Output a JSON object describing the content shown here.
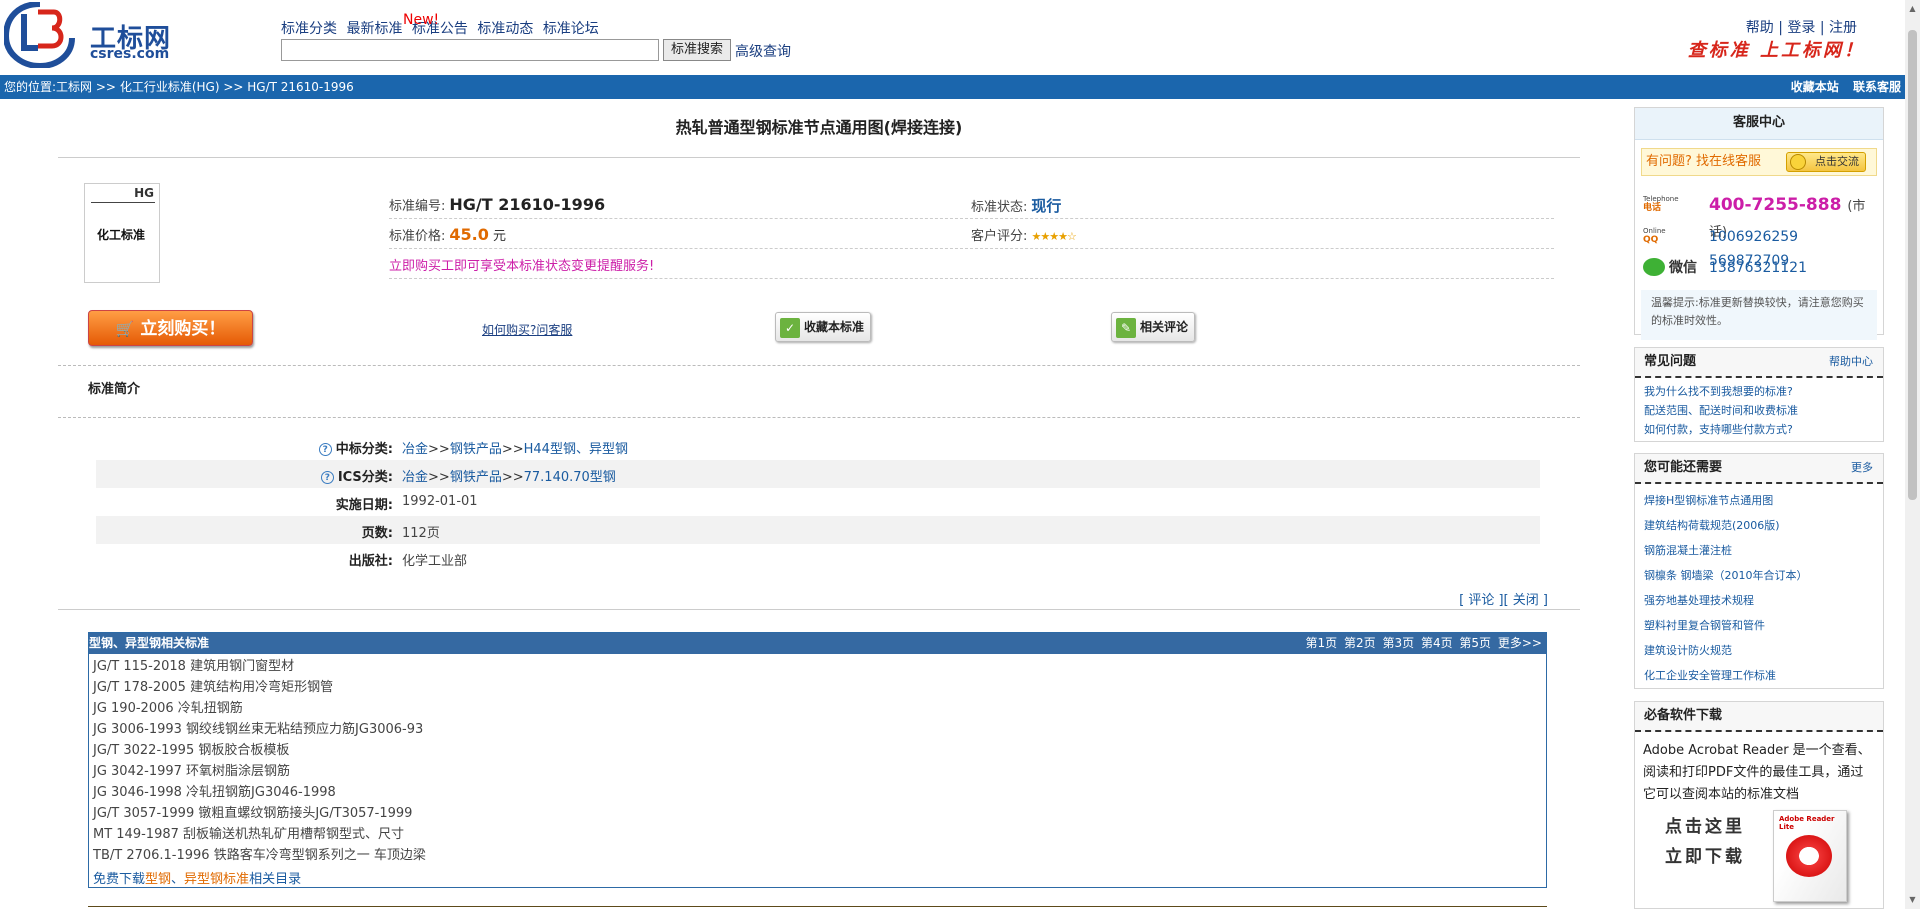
{
  "header": {
    "logo_cn": "工标网",
    "logo_en": "csres.com",
    "nav": [
      "标准分类",
      "最新标准",
      "标准公告",
      "标准动态",
      "标准论坛"
    ],
    "new_badge": "New!",
    "search_placeholder": "",
    "search_button": "标准搜索",
    "advanced_search": "高级查询",
    "links": [
      "帮助",
      "登录",
      "注册"
    ],
    "slogan": "查标准 上工标网！"
  },
  "breadcrumb": {
    "prefix": "您的位置:",
    "items": [
      "工标网",
      "化工行业标准(HG)",
      "HG/T 21610-1996"
    ],
    "right_links": [
      "收藏本站",
      "联系客服"
    ]
  },
  "standard": {
    "title": "热轧普通型钢标准节点通用图(焊接连接)",
    "thumb_code": "HG",
    "thumb_text": "化工标准",
    "code_label": "标准编号:",
    "code": "HG/T 21610-1996",
    "status_label": "标准状态:",
    "status": "现行",
    "price_label": "标准价格:",
    "price": "45.0",
    "price_unit": "元",
    "rating_label": "客户评分:",
    "rating_stars": "★★★★☆",
    "promo": "立即购买工即可享受本标准状态变更提醒服务!",
    "buy_button": "立刻购买！",
    "how_to_buy": "如何购买?",
    "ask_service": "问客服",
    "favorite_button": "收藏本标准",
    "comments_button": "相关评论"
  },
  "intro": {
    "title": "标准简介",
    "rows": [
      {
        "label": "中标分类:",
        "help": true,
        "parts": [
          "冶金",
          "钢铁产品",
          "H44型钢、异型钢"
        ]
      },
      {
        "label": "ICS分类:",
        "help": true,
        "parts": [
          "冶金",
          "钢铁产品",
          "77.140.70型钢"
        ]
      },
      {
        "label": "实施日期:",
        "help": false,
        "value": "1992-01-01"
      },
      {
        "label": "页数:",
        "help": false,
        "value": "112页"
      },
      {
        "label": "出版社:",
        "help": false,
        "value": "化学工业部"
      }
    ],
    "review_link": "评论",
    "close_link": "关闭"
  },
  "related": {
    "title": "型钢、异型钢相关标准",
    "pages": [
      "第1页",
      "第2页",
      "第3页",
      "第4页",
      "第5页",
      "更多>>"
    ],
    "items": [
      "JG/T 115-2018 建筑用钢门窗型材",
      "JG/T 178-2005 建筑结构用冷弯矩形钢管",
      "JG 190-2006 冷轧扭钢筋",
      "JG 3006-1993 钢绞线钢丝束无粘结预应力筋JG3006-93",
      "JG/T 3022-1995 钢板胶合板模板",
      "JG 3042-1997 环氧树脂涂层钢筋",
      "JG 3046-1998 冷轧扭钢筋JG3046-1998",
      "JG/T 3057-1999 镦粗直螺纹钢筋接头JG/T3057-1999",
      "MT 149-1987 刮板输送机热轧矿用槽帮钢型式、尺寸",
      "TB/T 2706.1-1996 铁路客车冷弯型钢系列之一 车顶边梁"
    ],
    "download_prefix": "免费下载",
    "download_kw1": "型钢",
    "download_sep": "、",
    "download_kw2": "异型钢标准",
    "download_suffix": "相关目录"
  },
  "sidebar": {
    "service": {
      "title": "客服中心",
      "ask": "有问题? 找在线客服",
      "chat_button": "点击交流",
      "phone_icon": "电话",
      "phone_icon_en": "Telephone",
      "phone": "400-7255-888",
      "phone_note": "(市话)",
      "qq_icon": "QQ",
      "qq_icon_en": "Online",
      "qq": "1006926259 569872709",
      "wechat_label": "微信",
      "wechat": "13876321121",
      "tip": "温馨提示:标准更新替换较快，请注意您购买的标准时效性。"
    },
    "faq": {
      "title": "常见问题",
      "more": "帮助中心",
      "items": [
        "我为什么找不到我想要的标准?",
        "配送范围、配送时间和收费标准",
        "如何付款，支持哪些付款方式?"
      ]
    },
    "need": {
      "title": "您可能还需要",
      "more": "更多",
      "items": [
        "焊接H型钢标准节点通用图",
        "建筑结构荷载规范(2006版)",
        "钢筋混凝土灌注桩",
        "钢檩条 钢墙梁（2010年合订本）",
        "强夯地基处理技术规程",
        "塑料衬里复合钢管和管件",
        "建筑设计防火规范",
        "化工企业安全管理工作标准"
      ]
    },
    "software": {
      "title": "必备软件下载",
      "text": "Adobe Acrobat Reader 是一个查看、阅读和打印PDF文件的最佳工具，通过它可以查阅本站的标准文档",
      "download_line1": "点击这里",
      "download_line2": "立即下载",
      "box_label": "Adobe Reader Lite"
    }
  }
}
